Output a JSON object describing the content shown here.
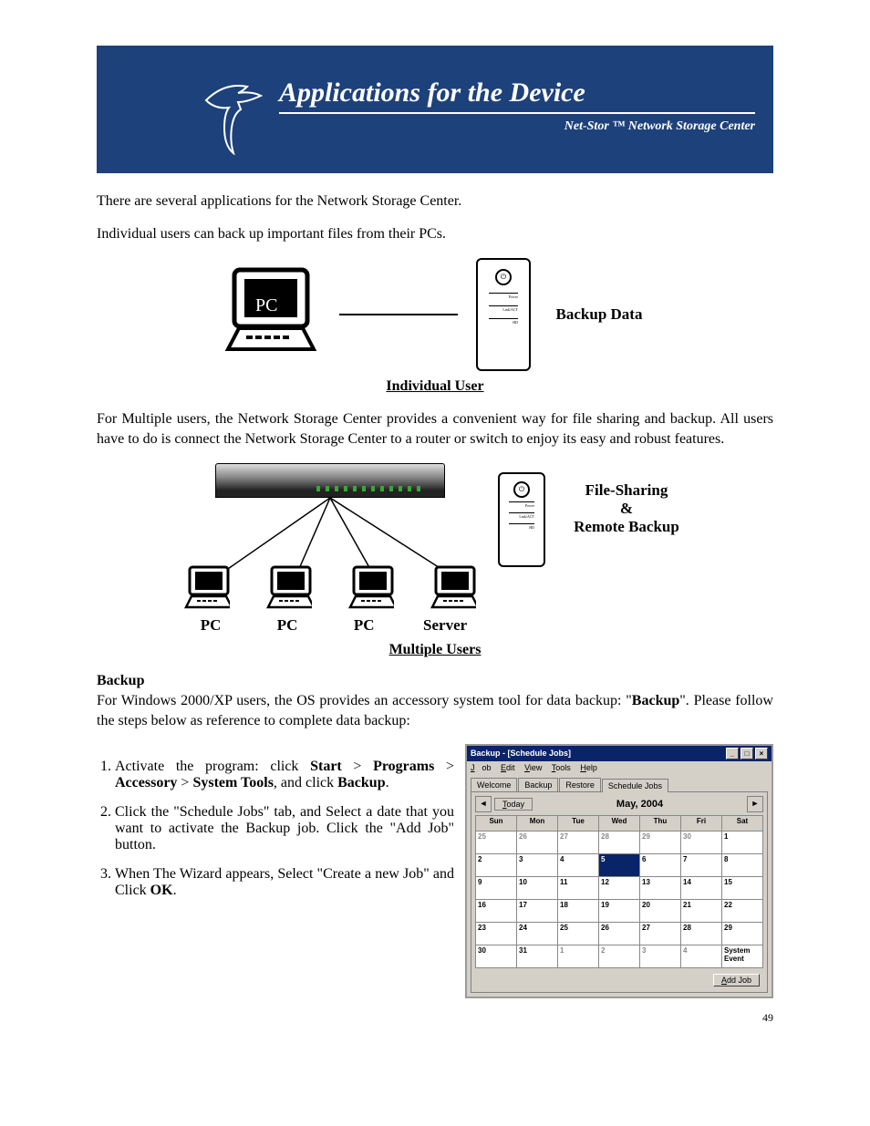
{
  "banner": {
    "title": "Applications for the Device",
    "subtitle": "Net-Stor ™ Network Storage Center"
  },
  "intro1": "There are several applications for the Network Storage Center.",
  "intro2": "Individual users can back up important files from their PCs.",
  "diagram1": {
    "pc_label": "PC",
    "side_label": "Backup Data",
    "caption": "Individual User"
  },
  "multi_intro": "For Multiple users, the Network Storage Center provides a convenient way for file sharing and backup. All users have to do is connect the Network Storage Center to a router or switch to enjoy its easy and robust features.",
  "diagram2": {
    "side1": "File-Sharing",
    "side2": "&",
    "side3": "Remote Backup",
    "labels": [
      "PC",
      "PC",
      "PC",
      "Server"
    ],
    "caption": "Multiple Users"
  },
  "backup": {
    "heading": "Backup",
    "para_a": "For Windows 2000/XP users, the OS provides an accessory system tool for data backup: \"",
    "para_b": "Backup",
    "para_c": "\". Please follow the steps below as reference to complete data backup:",
    "step1_a": "Activate the program: click ",
    "step1_b": "Start",
    "step1_c": " > ",
    "step1_d": "Programs",
    "step1_e": " > ",
    "step1_f": "Accessory",
    "step1_g": " > ",
    "step1_h": "System Tools",
    "step1_i": ", and click ",
    "step1_j": "Backup",
    "step1_k": ".",
    "step2": "Click the \"Schedule Jobs\" tab, and Select a date that you want to activate the Backup job. Click the \"Add Job\" button.",
    "step3_a": "When The Wizard appears, Select \"Create a new Job\" and Click ",
    "step3_b": "OK",
    "step3_c": "."
  },
  "screenshot": {
    "title": "Backup - [Schedule Jobs]",
    "menus": {
      "job": "Job",
      "edit": "Edit",
      "view": "View",
      "tools": "Tools",
      "help": "Help"
    },
    "tabs": [
      "Welcome",
      "Backup",
      "Restore",
      "Schedule Jobs"
    ],
    "nav_prev": "◄",
    "nav_next": "►",
    "today": "Today",
    "month": "May, 2004",
    "days": [
      "Sun",
      "Mon",
      "Tue",
      "Wed",
      "Thu",
      "Fri",
      "Sat"
    ],
    "weeks": [
      [
        "25",
        "26",
        "27",
        "28",
        "29",
        "30",
        "1"
      ],
      [
        "2",
        "3",
        "4",
        "5",
        "6",
        "7",
        "8"
      ],
      [
        "9",
        "10",
        "11",
        "12",
        "13",
        "14",
        "15"
      ],
      [
        "16",
        "17",
        "18",
        "19",
        "20",
        "21",
        "22"
      ],
      [
        "23",
        "24",
        "25",
        "26",
        "27",
        "28",
        "29"
      ],
      [
        "30",
        "31",
        "1",
        "2",
        "3",
        "4",
        "System Event"
      ]
    ],
    "selected": "5",
    "addjob": "Add Job"
  },
  "page": "49"
}
